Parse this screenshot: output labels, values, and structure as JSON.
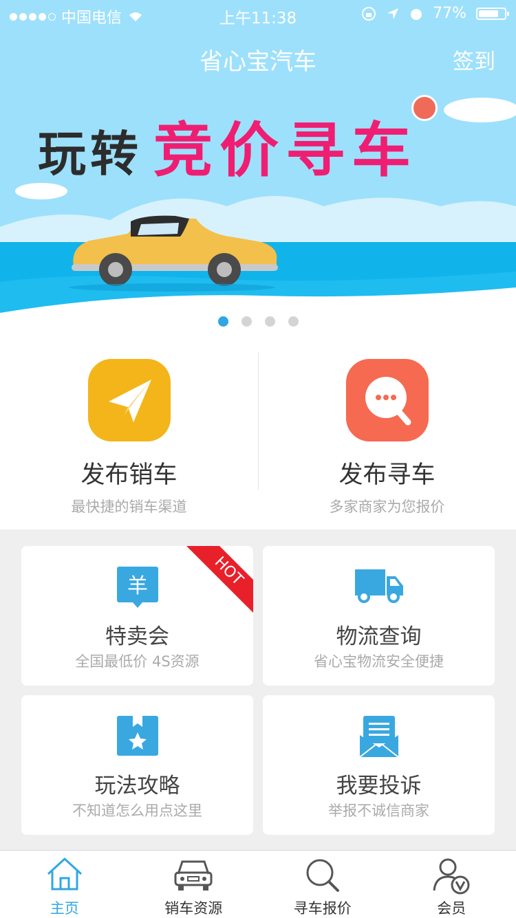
{
  "status_bar": {
    "carrier": "中国电信",
    "time": "上午11:38",
    "battery": "77%"
  },
  "nav": {
    "title": "省心宝汽车",
    "right_action": "签到"
  },
  "banner": {
    "text_dark": "玩转",
    "text_pink": "竞价寻车",
    "slides": 4,
    "active_slide": 0
  },
  "actions": [
    {
      "title": "发布销车",
      "subtitle": "最快捷的销车渠道",
      "icon": "paper-plane-icon",
      "color": "#f3b51a"
    },
    {
      "title": "发布寻车",
      "subtitle": "多家商家为您报价",
      "icon": "chat-search-icon",
      "color": "#f56a50"
    }
  ],
  "grid": [
    {
      "title": "特卖会",
      "subtitle": "全国最低价 4S资源",
      "icon": "yuan-tag-icon",
      "badge": "HOT",
      "icon_symbol": "羊"
    },
    {
      "title": "物流查询",
      "subtitle": "省心宝物流安全便捷",
      "icon": "truck-icon"
    },
    {
      "title": "玩法攻略",
      "subtitle": "不知道怎么用点这里",
      "icon": "bookmark-star-icon"
    },
    {
      "title": "我要投诉",
      "subtitle": "举报不诚信商家",
      "icon": "envelope-icon"
    }
  ],
  "tabs": [
    {
      "label": "主页",
      "icon": "home-icon",
      "active": true
    },
    {
      "label": "销车资源",
      "icon": "car-icon",
      "active": false
    },
    {
      "label": "寻车报价",
      "icon": "search-icon",
      "active": false
    },
    {
      "label": "会员",
      "icon": "member-icon",
      "active": false
    }
  ],
  "colors": {
    "accent": "#2fa7e3",
    "icon_blue": "#3aa8e0",
    "hot": "#e8202a",
    "banner_pink": "#ef1e72"
  }
}
